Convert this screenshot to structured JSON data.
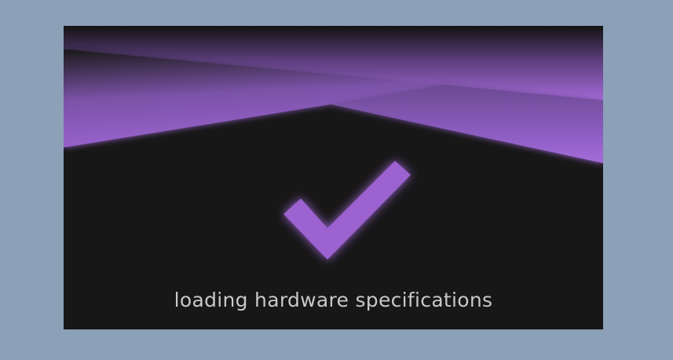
{
  "splash": {
    "status_text": "loading hardware specifications",
    "icon": "checkmark-icon"
  },
  "colors": {
    "page_background": "#8ca0b8",
    "splash_background": "#171717",
    "accent": "#9b62d0",
    "status_text": "#c8c8c8"
  }
}
